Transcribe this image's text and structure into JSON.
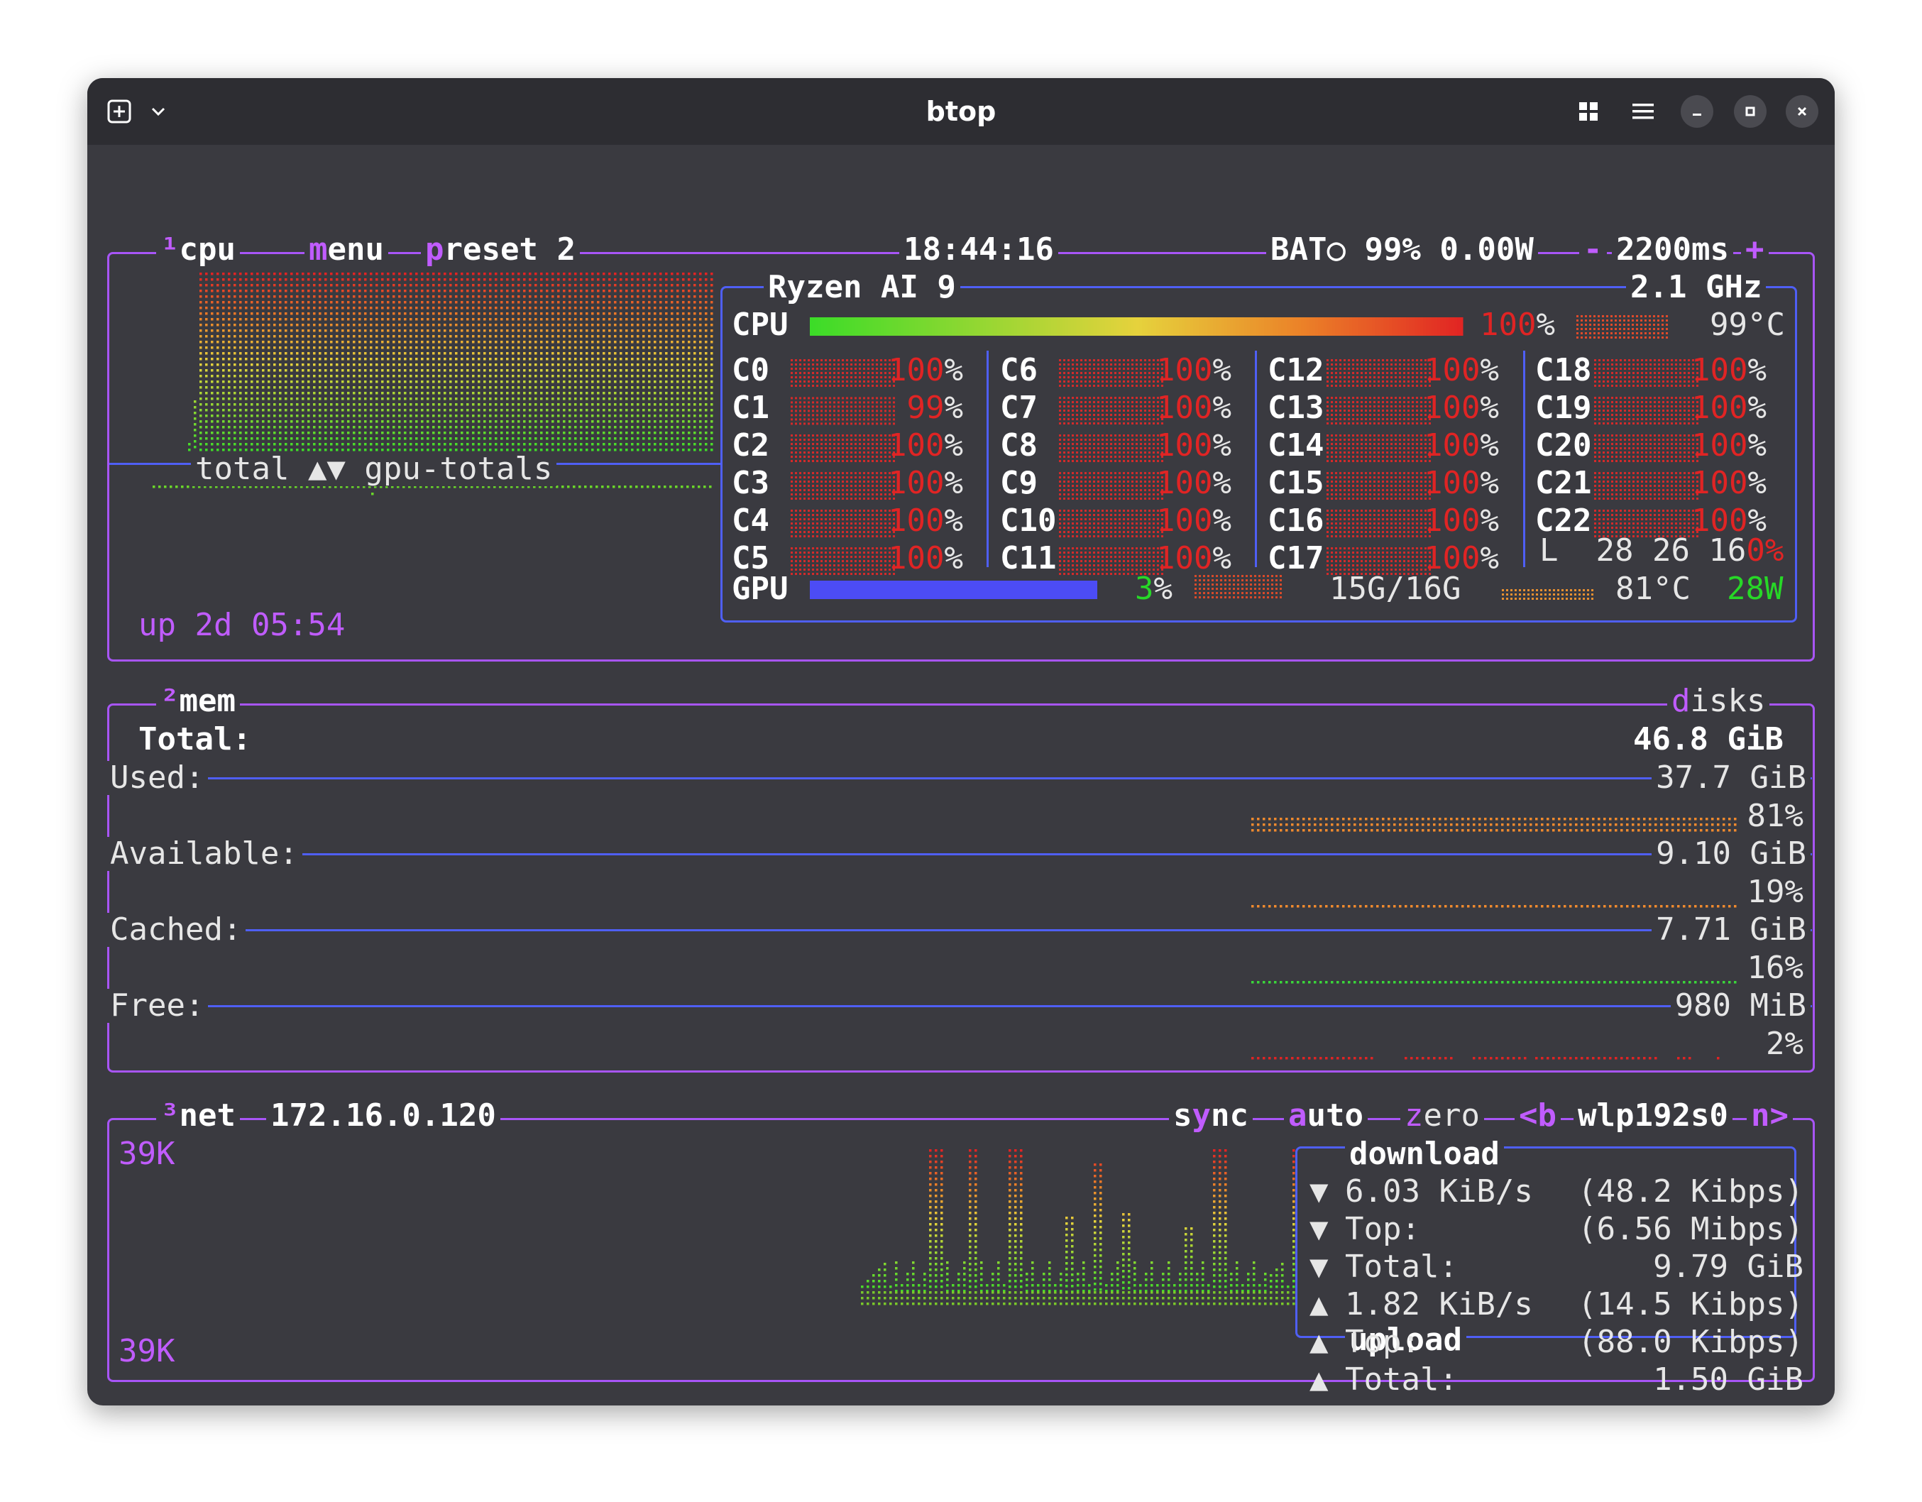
{
  "window": {
    "title": "btop",
    "new_tab_icon": "new-tab-icon",
    "dropdown_icon": "chevron-down-icon",
    "grid_icon": "grid-view-icon",
    "menu_icon": "hamburger-menu-icon",
    "minimize_icon": "minimize-icon",
    "maximize_icon": "maximize-icon",
    "close_icon": "close-icon"
  },
  "cpu_panel": {
    "num": "¹",
    "title": "cpu",
    "menu": "menu",
    "preset": "preset 2",
    "clock": "18:44:16",
    "battery": "BAT○ 99% 0.00W",
    "interval_minus": "-",
    "interval": "2200ms",
    "interval_plus": "+",
    "graph_label": "total ▲▼ gpu-totals",
    "uptime": "up 2d 05:54",
    "model": "Ryzen AI 9",
    "freq": "2.1 GHz",
    "cpu_label": "CPU",
    "cpu_pct_num": "100",
    "cpu_temp": "99°C",
    "cpu_total_percent": 100,
    "cores": [
      {
        "name": "C0",
        "pct": "100",
        "val": 100
      },
      {
        "name": "C1",
        "pct": "99",
        "val": 99
      },
      {
        "name": "C2",
        "pct": "100",
        "val": 100
      },
      {
        "name": "C3",
        "pct": "100",
        "val": 100
      },
      {
        "name": "C4",
        "pct": "100",
        "val": 100
      },
      {
        "name": "C5",
        "pct": "100",
        "val": 100
      },
      {
        "name": "C6",
        "pct": "100",
        "val": 100
      },
      {
        "name": "C7",
        "pct": "100",
        "val": 100
      },
      {
        "name": "C8",
        "pct": "100",
        "val": 100
      },
      {
        "name": "C9",
        "pct": "100",
        "val": 100
      },
      {
        "name": "C10",
        "pct": "100",
        "val": 100
      },
      {
        "name": "C11",
        "pct": "100",
        "val": 100
      },
      {
        "name": "C12",
        "pct": "100",
        "val": 100
      },
      {
        "name": "C13",
        "pct": "100",
        "val": 100
      },
      {
        "name": "C14",
        "pct": "100",
        "val": 100
      },
      {
        "name": "C15",
        "pct": "100",
        "val": 100
      },
      {
        "name": "C16",
        "pct": "100",
        "val": 100
      },
      {
        "name": "C17",
        "pct": "100",
        "val": 100
      },
      {
        "name": "C18",
        "pct": "100",
        "val": 100
      },
      {
        "name": "C19",
        "pct": "100",
        "val": 100
      },
      {
        "name": "C20",
        "pct": "100",
        "val": 100
      },
      {
        "name": "C21",
        "pct": "100",
        "val": 100
      },
      {
        "name": "C22",
        "pct": "100",
        "val": 100
      }
    ],
    "load_label": "L",
    "load_values": "28 26 16",
    "load_tail": "0%",
    "gpu_label": "GPU",
    "gpu_pct_num": "3",
    "gpu_percent": 3,
    "gpu_mem": "15G/16G",
    "gpu_temp": "81°C",
    "gpu_power": "28W"
  },
  "mem_panel": {
    "num": "²",
    "title": "mem",
    "disks": "disks",
    "total_label": "Total:",
    "total_value": "46.8 GiB",
    "rows": [
      {
        "label": "Used:",
        "value": "37.7 GiB",
        "pct": "81%",
        "val": 81,
        "color": "#f08a2e"
      },
      {
        "label": "Available:",
        "value": "9.10 GiB",
        "pct": "19%",
        "val": 19,
        "color": "#f08a2e"
      },
      {
        "label": "Cached:",
        "value": "7.71 GiB",
        "pct": "16%",
        "val": 16,
        "color": "#3ad63a"
      },
      {
        "label": "Free:",
        "value": "980 MiB",
        "pct": "2%",
        "val": 2,
        "color": "#e02424"
      }
    ]
  },
  "net_panel": {
    "num": "³",
    "title": "net",
    "ip": "172.16.0.120",
    "sync": "sync",
    "auto": "auto",
    "zero": "zero",
    "prev": "<b",
    "iface": "wlp192s0",
    "next": "n>",
    "scale_top": "39K",
    "scale_bottom": "39K",
    "download_title": "download",
    "upload_title": "upload",
    "stats": [
      {
        "arrow": "▼",
        "label": "6.03 KiB/s",
        "value": "(48.2 Kibps)"
      },
      {
        "arrow": "▼",
        "label": "Top:",
        "value": "(6.56 Mibps)"
      },
      {
        "arrow": "▼",
        "label": "Total:",
        "value": "9.79 GiB"
      },
      {
        "arrow": "▲",
        "label": "1.82 KiB/s",
        "value": "(14.5 Kibps)"
      },
      {
        "arrow": "▲",
        "label": "Top:",
        "value": "(88.0 Kibps)"
      },
      {
        "arrow": "▲",
        "label": "Total:",
        "value": "1.50 GiB"
      }
    ]
  }
}
